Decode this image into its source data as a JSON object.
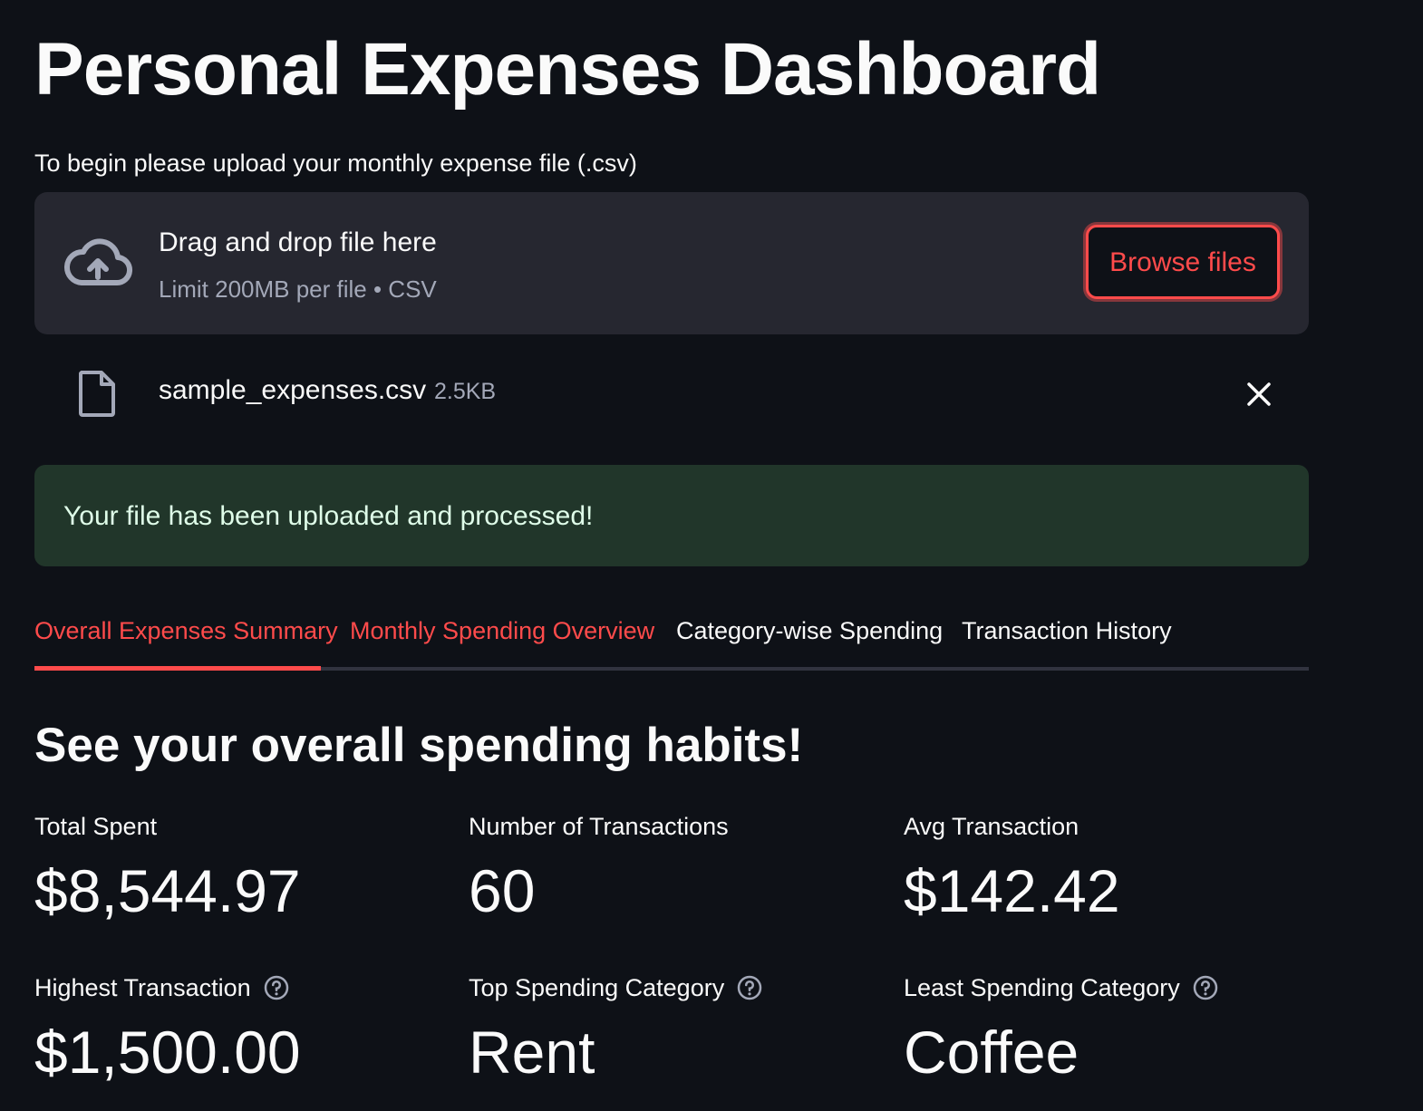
{
  "page": {
    "title": "Personal Expenses Dashboard"
  },
  "upload": {
    "label": "To begin please upload your monthly expense file (.csv)",
    "dropzone_main": "Drag and drop file here",
    "dropzone_sub": "Limit 200MB per file • CSV",
    "browse_label": "Browse files",
    "file_name": "sample_expenses.csv",
    "file_size": "2.5KB",
    "icons": {
      "dropzone": "cloud-upload-icon",
      "file": "file-icon",
      "remove": "close-icon"
    }
  },
  "alert": {
    "success_text": "Your file has been uploaded and processed!"
  },
  "tabs": [
    {
      "label": "Overall Expenses Summary",
      "active": true
    },
    {
      "label": "Monthly Spending Overview",
      "active": false
    },
    {
      "label": "Category-wise Spending",
      "active": false
    },
    {
      "label": "Transaction History",
      "active": false
    }
  ],
  "summary": {
    "heading": "See your overall spending habits!",
    "metrics": [
      {
        "label": "Total Spent",
        "value": "$8,544.97",
        "help": false
      },
      {
        "label": "Number of Transactions",
        "value": "60",
        "help": false
      },
      {
        "label": "Avg Transaction",
        "value": "$142.42",
        "help": false
      },
      {
        "label": "Highest Transaction",
        "value": "$1,500.00",
        "help": true
      },
      {
        "label": "Top Spending Category",
        "value": "Rent",
        "help": true
      },
      {
        "label": "Least Spending Category",
        "value": "Coffee",
        "help": true
      }
    ]
  },
  "colors": {
    "background": "#0e1117",
    "surface": "#262730",
    "accent": "#ff4b4b",
    "success_bg": "#21362a",
    "success_text": "#dffde9",
    "muted_text": "#a3a8b8"
  }
}
